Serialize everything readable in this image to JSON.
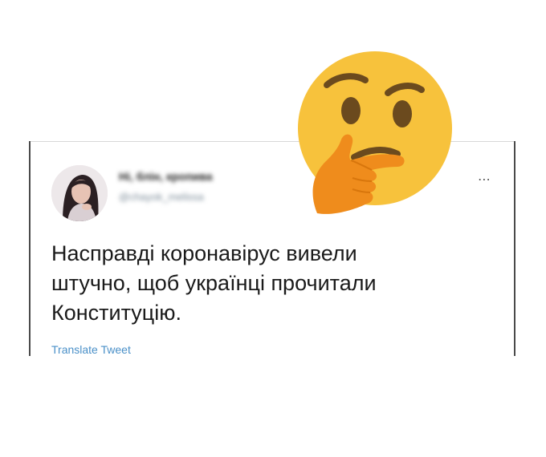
{
  "tweet": {
    "display_name": "Ні, блін, кропива",
    "handle": "@chayok_melissa",
    "more_icon": "⋯",
    "text_lines": [
      "Насправді коронавірус вивели",
      "штучно, щоб українці прочитали",
      "Конституцію."
    ],
    "translate_label": "Translate Tweet"
  },
  "colors": {
    "link": "#4a90c8",
    "emoji_face": "#f7c23c",
    "emoji_hand": "#ef8c1c"
  },
  "overlay": {
    "icon": "thinking-face-emoji"
  }
}
